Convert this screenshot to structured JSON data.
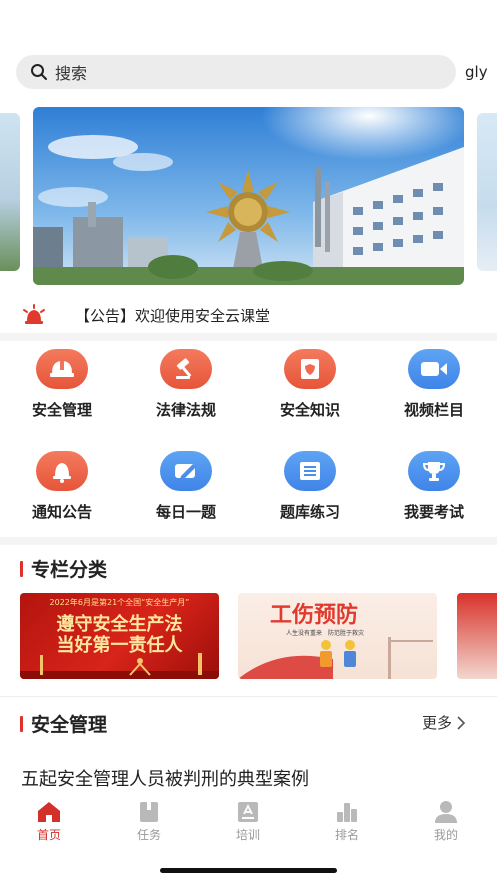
{
  "search": {
    "placeholder": "搜索"
  },
  "user": {
    "name": "gly"
  },
  "notice": {
    "text": "【公告】欢迎使用安全云课堂"
  },
  "grid": [
    {
      "label": "安全管理",
      "icon": "helmet-icon",
      "color": "red"
    },
    {
      "label": "法律法规",
      "icon": "gavel-icon",
      "color": "red"
    },
    {
      "label": "安全知识",
      "icon": "book-shield-icon",
      "color": "red"
    },
    {
      "label": "视频栏目",
      "icon": "video-camera-icon",
      "color": "blue"
    },
    {
      "label": "通知公告",
      "icon": "bell-icon",
      "color": "red"
    },
    {
      "label": "每日一题",
      "icon": "pencil-icon",
      "color": "blue"
    },
    {
      "label": "题库练习",
      "icon": "list-icon",
      "color": "blue"
    },
    {
      "label": "我要考试",
      "icon": "trophy-icon",
      "color": "blue"
    }
  ],
  "columns": {
    "title": "专栏分类",
    "cards": [
      {
        "top": "2022年6月是第21个全国“安全生产月”",
        "line1": "遵守安全生产法",
        "line2": "当好第一责任人"
      },
      {
        "title": "工伤预防",
        "sub": "人生没有重来　防范胜于救灾"
      }
    ]
  },
  "safety": {
    "title": "安全管理",
    "more": "更多"
  },
  "article": {
    "title": "五起安全管理人员被判刑的典型案例"
  },
  "tabs": [
    {
      "label": "首页",
      "icon": "home-icon",
      "active": true
    },
    {
      "label": "任务",
      "icon": "task-icon",
      "active": false
    },
    {
      "label": "培训",
      "icon": "training-icon",
      "active": false
    },
    {
      "label": "排名",
      "icon": "ranking-icon",
      "active": false
    },
    {
      "label": "我的",
      "icon": "profile-icon",
      "active": false
    }
  ],
  "colors": {
    "accent": "#d3302a",
    "red_icon": "#e6553a",
    "blue_icon": "#3f84e8",
    "tab_inactive": "#9a9a9a"
  }
}
